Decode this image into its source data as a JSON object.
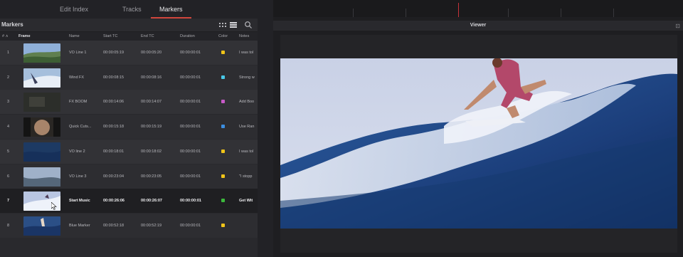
{
  "tabs": [
    "Edit Index",
    "Tracks",
    "Markers"
  ],
  "active_tab": "Markers",
  "panel": {
    "title": "Markers"
  },
  "columns": {
    "index": "#",
    "frame": "Frame",
    "name": "Name",
    "start": "Start TC",
    "end": "End TC",
    "duration": "Duration",
    "color": "Color",
    "notes": "Notes"
  },
  "rows": [
    {
      "num": "1",
      "name": "VO Line 1",
      "start": "00:00:05:19",
      "end": "00:00:05:20",
      "duration": "00:00:00:01",
      "color": "#f0c419",
      "notes": "I was tol"
    },
    {
      "num": "2",
      "name": "Wind FX",
      "start": "00:00:08:15",
      "end": "00:00:08:16",
      "duration": "00:00:00:01",
      "color": "#48c8e8",
      "notes": "Strong w"
    },
    {
      "num": "3",
      "name": "FX BOOM",
      "start": "00:00:14:06",
      "end": "00:00:14:07",
      "duration": "00:00:00:01",
      "color": "#c85ac8",
      "notes": "Add Boo"
    },
    {
      "num": "4",
      "name": "Quick Cuts...",
      "start": "00:00:15:18",
      "end": "00:00:15:19",
      "duration": "00:00:00:01",
      "color": "#3c8ee0",
      "notes": "Use Ran"
    },
    {
      "num": "5",
      "name": "VO line 2",
      "start": "00:00:18:01",
      "end": "00:00:18:02",
      "duration": "00:00:00:01",
      "color": "#f0c419",
      "notes": "I was tol"
    },
    {
      "num": "6",
      "name": "VO Line 3",
      "start": "00:00:23:04",
      "end": "00:00:23:05",
      "duration": "00:00:00:01",
      "color": "#f0c419",
      "notes": "\"I stopp"
    },
    {
      "num": "7",
      "name": "Start Music",
      "start": "00:00:26:06",
      "end": "00:00:26:07",
      "duration": "00:00:00:01",
      "color": "#3cb83c",
      "notes": "Get Wit"
    },
    {
      "num": "8",
      "name": "Blue Marker",
      "start": "00:00:52:18",
      "end": "00:00:52:19",
      "duration": "00:00:00:01",
      "color": "#f0c419",
      "notes": ""
    }
  ],
  "selected_row": "7",
  "viewer": {
    "title": "Viewer"
  },
  "icons": [
    "grid-view-icon",
    "list-view-icon",
    "search-icon",
    "viewer-options-icon"
  ],
  "colors": {
    "accent_tab": "#d0463c",
    "playhead": "#c6323a"
  }
}
